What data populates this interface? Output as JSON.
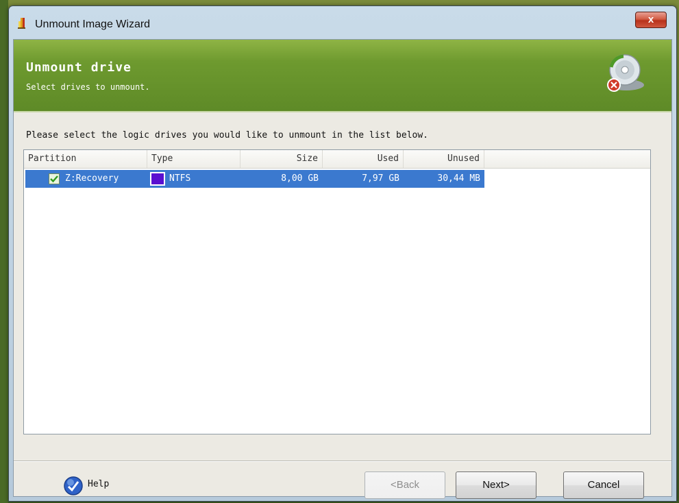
{
  "window": {
    "title": "Unmount Image Wizard",
    "close_glyph": "x"
  },
  "header": {
    "title": "Unmount drive",
    "subtitle": "Select drives to unmount."
  },
  "instruction": "Please select the logic drives you would like to unmount in the list below.",
  "list": {
    "columns": [
      "Partition",
      "Type",
      "Size",
      "Used",
      "Unused"
    ],
    "rows": [
      {
        "checked": true,
        "partition": "Z:Recovery",
        "type": "NTFS",
        "type_color": "#5a0fd0",
        "size": "8,00 GB",
        "used": "7,97 GB",
        "unused": "30,44 MB"
      }
    ]
  },
  "footer": {
    "help": "Help",
    "back": "<Back",
    "next": "Next>",
    "cancel": "Cancel"
  },
  "colors": {
    "header_green": "#6e9a2f",
    "selection_blue": "#3b79cf",
    "close_red": "#c8452b"
  },
  "icons": [
    "wizard-icon",
    "disc-unmount-icon",
    "checkbox-icon",
    "help-icon"
  ]
}
